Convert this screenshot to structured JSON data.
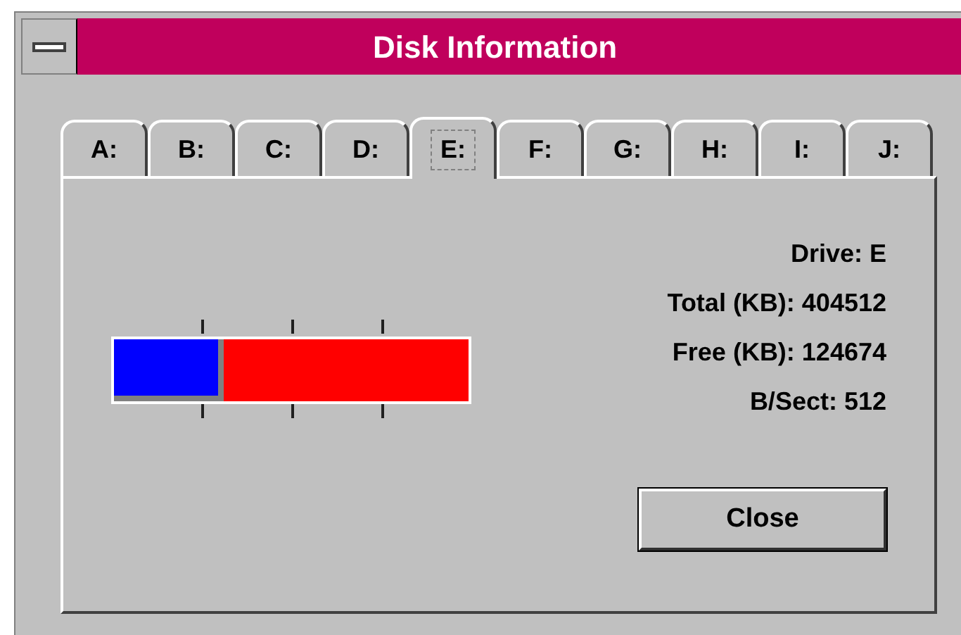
{
  "window": {
    "title": "Disk Information"
  },
  "tabs": [
    {
      "label": "A:",
      "selected": false
    },
    {
      "label": "B:",
      "selected": false
    },
    {
      "label": "C:",
      "selected": false
    },
    {
      "label": "D:",
      "selected": false
    },
    {
      "label": "E:",
      "selected": true
    },
    {
      "label": "F:",
      "selected": false
    },
    {
      "label": "G:",
      "selected": false
    },
    {
      "label": "H:",
      "selected": false
    },
    {
      "label": "I:",
      "selected": false
    },
    {
      "label": "J:",
      "selected": false
    }
  ],
  "usage_bar": {
    "level": 0.31
  },
  "info": [
    "Drive: E",
    "Total (KB): 404512",
    "Free (KB): 124674",
    "B/Sect: 512"
  ],
  "buttons": [
    "Close"
  ]
}
